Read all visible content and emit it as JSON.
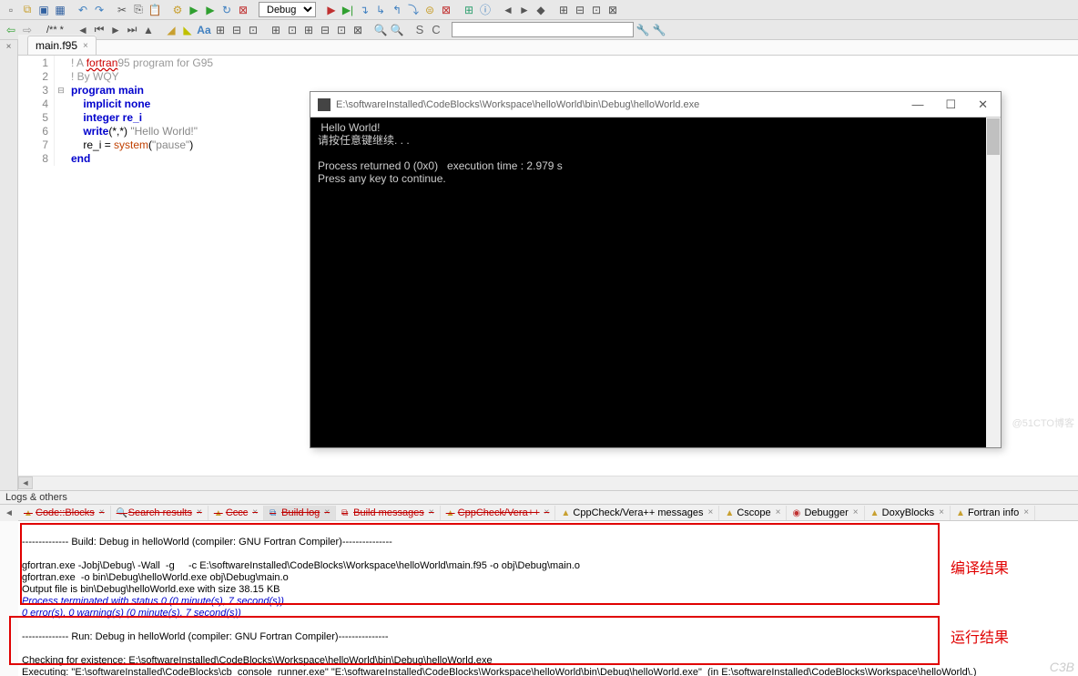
{
  "toolbar1": {
    "debug_label": "Debug",
    "doc_label": "/** *"
  },
  "tab": {
    "filename": "main.f95"
  },
  "code": {
    "line_numbers": [
      "1",
      "2",
      "3",
      "4",
      "5",
      "6",
      "7",
      "8"
    ],
    "l1_pre": "! A ",
    "l1_err": "fortran",
    "l1_post": "95 program for G95",
    "l2": "! By WQY",
    "l3": "program main",
    "l4": "implicit none",
    "l5": "integer re_i",
    "l6_a": "write",
    "l6_b": "(*,*) ",
    "l6_c": "\"Hello World!\"",
    "l7_a": "re_i = ",
    "l7_b": "system",
    "l7_c": "(",
    "l7_d": "\"pause\"",
    "l7_e": ")",
    "l8": "end"
  },
  "console": {
    "title": "E:\\softwareInstalled\\CodeBlocks\\Workspace\\helloWorld\\bin\\Debug\\helloWorld.exe",
    "l1": " Hello World!",
    "l2": "请按任意键继续. . .",
    "l3": "Process returned 0 (0x0)   execution time : 2.979 s",
    "l4": "Press any key to continue."
  },
  "logs_header": "Logs & others",
  "btabs": {
    "t1": "Code::Blocks",
    "t2": "Search results",
    "t3": "Cccc",
    "t4": "Build log",
    "t5": "Build messages",
    "t6": "CppCheck/Vera++",
    "t7": "CppCheck/Vera++ messages",
    "t8": "Cscope",
    "t9": "Debugger",
    "t10": "DoxyBlocks",
    "t11": "Fortran info"
  },
  "buildlog": {
    "l1": "-------------- Build: Debug in helloWorld (compiler: GNU Fortran Compiler)---------------",
    "l2": "gfortran.exe -Jobj\\Debug\\ -Wall  -g     -c E:\\softwareInstalled\\CodeBlocks\\Workspace\\helloWorld\\main.f95 -o obj\\Debug\\main.o",
    "l3": "gfortran.exe  -o bin\\Debug\\helloWorld.exe obj\\Debug\\main.o",
    "l4": "Output file is bin\\Debug\\helloWorld.exe with size 38.15 KB",
    "l5": "Process terminated with status 0 (0 minute(s), 7 second(s))",
    "l6": "0 error(s), 0 warning(s) (0 minute(s), 7 second(s))",
    "r1": "-------------- Run: Debug in helloWorld (compiler: GNU Fortran Compiler)---------------",
    "r2": "Checking for existence: E:\\softwareInstalled\\CodeBlocks\\Workspace\\helloWorld\\bin\\Debug\\helloWorld.exe",
    "r3": "Executing: \"E:\\softwareInstalled\\CodeBlocks\\cb_console_runner.exe\" \"E:\\softwareInstalled\\CodeBlocks\\Workspace\\helloWorld\\bin\\Debug\\helloWorld.exe\"  (in E:\\softwareInstalled\\CodeBlocks\\Workspace\\helloWorld\\.)"
  },
  "annotations": {
    "compile": "编译结果",
    "run": "运行结果"
  },
  "watermark": "C3B",
  "watermark2": "@51CTO博客"
}
